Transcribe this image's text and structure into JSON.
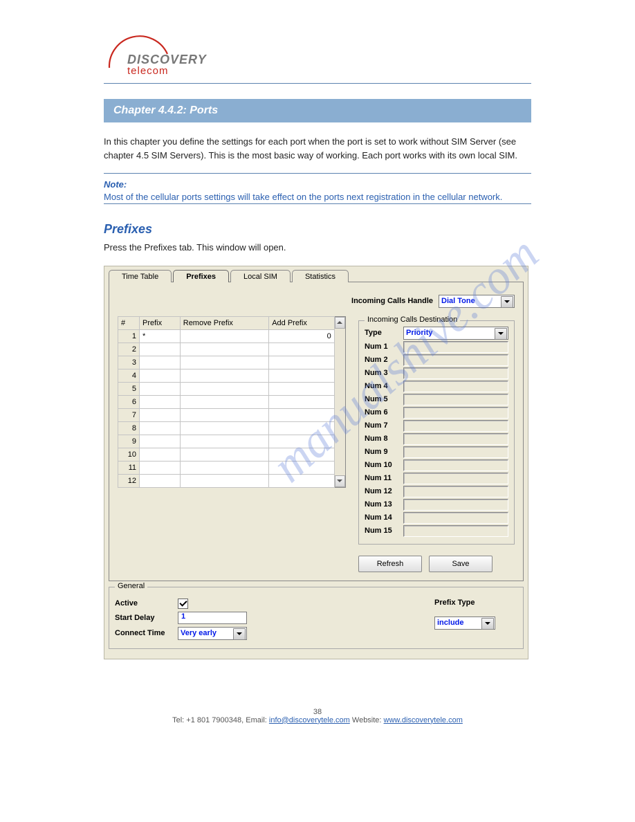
{
  "logo": {
    "top": "DISCOVERY",
    "bottom": "telecom"
  },
  "section_title": "Chapter 4.4.2: Ports",
  "intro_para": "In this chapter you define the settings for each port when the port is set to work without SIM Server (see chapter 4.5 SIM Servers). This is the most basic way of working. Each port works with its own local SIM.",
  "note_title": "Note:",
  "note_body": "Most of the cellular ports settings will take effect on the ports next registration in the cellular network.",
  "prefixes_heading": "Prefixes",
  "prefixes_para": "Press the Prefixes tab. This window will open.",
  "tabs": [
    "Time Table",
    "Prefixes",
    "Local SIM",
    "Statistics"
  ],
  "active_tab": "Prefixes",
  "ich_label": "Incoming Calls Handle",
  "ich_value": "Dial Tone",
  "grid": {
    "cols": [
      "#",
      "Prefix",
      "Remove Prefix",
      "Add Prefix"
    ],
    "rows": [
      {
        "n": 1,
        "prefix": "*",
        "remove": "",
        "add": "0"
      },
      {
        "n": 2,
        "prefix": "",
        "remove": "",
        "add": ""
      },
      {
        "n": 3,
        "prefix": "",
        "remove": "",
        "add": ""
      },
      {
        "n": 4,
        "prefix": "",
        "remove": "",
        "add": ""
      },
      {
        "n": 5,
        "prefix": "",
        "remove": "",
        "add": ""
      },
      {
        "n": 6,
        "prefix": "",
        "remove": "",
        "add": ""
      },
      {
        "n": 7,
        "prefix": "",
        "remove": "",
        "add": ""
      },
      {
        "n": 8,
        "prefix": "",
        "remove": "",
        "add": ""
      },
      {
        "n": 9,
        "prefix": "",
        "remove": "",
        "add": ""
      },
      {
        "n": 10,
        "prefix": "",
        "remove": "",
        "add": ""
      },
      {
        "n": 11,
        "prefix": "",
        "remove": "",
        "add": ""
      },
      {
        "n": 12,
        "prefix": "",
        "remove": "",
        "add": ""
      }
    ]
  },
  "dest": {
    "legend": "Incoming Calls Destination",
    "type_label": "Type",
    "type_value": "Priority",
    "labels": [
      "Num 1",
      "Num 2",
      "Num 3",
      "Num 4",
      "Num 5",
      "Num 6",
      "Num 7",
      "Num 8",
      "Num 9",
      "Num 10",
      "Num 11",
      "Num 12",
      "Num 13",
      "Num 14",
      "Num 15"
    ]
  },
  "general": {
    "legend": "General",
    "active_label": "Active",
    "active_checked": true,
    "start_delay_label": "Start Delay",
    "start_delay_value": "1",
    "connect_time_label": "Connect Time",
    "connect_time_value": "Very early",
    "prefix_type_label": "Prefix Type",
    "prefix_type_value": "include"
  },
  "buttons": {
    "refresh": "Refresh",
    "save": "Save"
  },
  "footer": {
    "page": "38",
    "tel_label": "Tel:",
    "tel": "+1 801 7900348",
    "email_label": "Email:",
    "email": "info@discoverytele.com",
    "site_label": "Website:",
    "site": "www.discoverytele.com"
  },
  "watermark": "manualshive.com"
}
